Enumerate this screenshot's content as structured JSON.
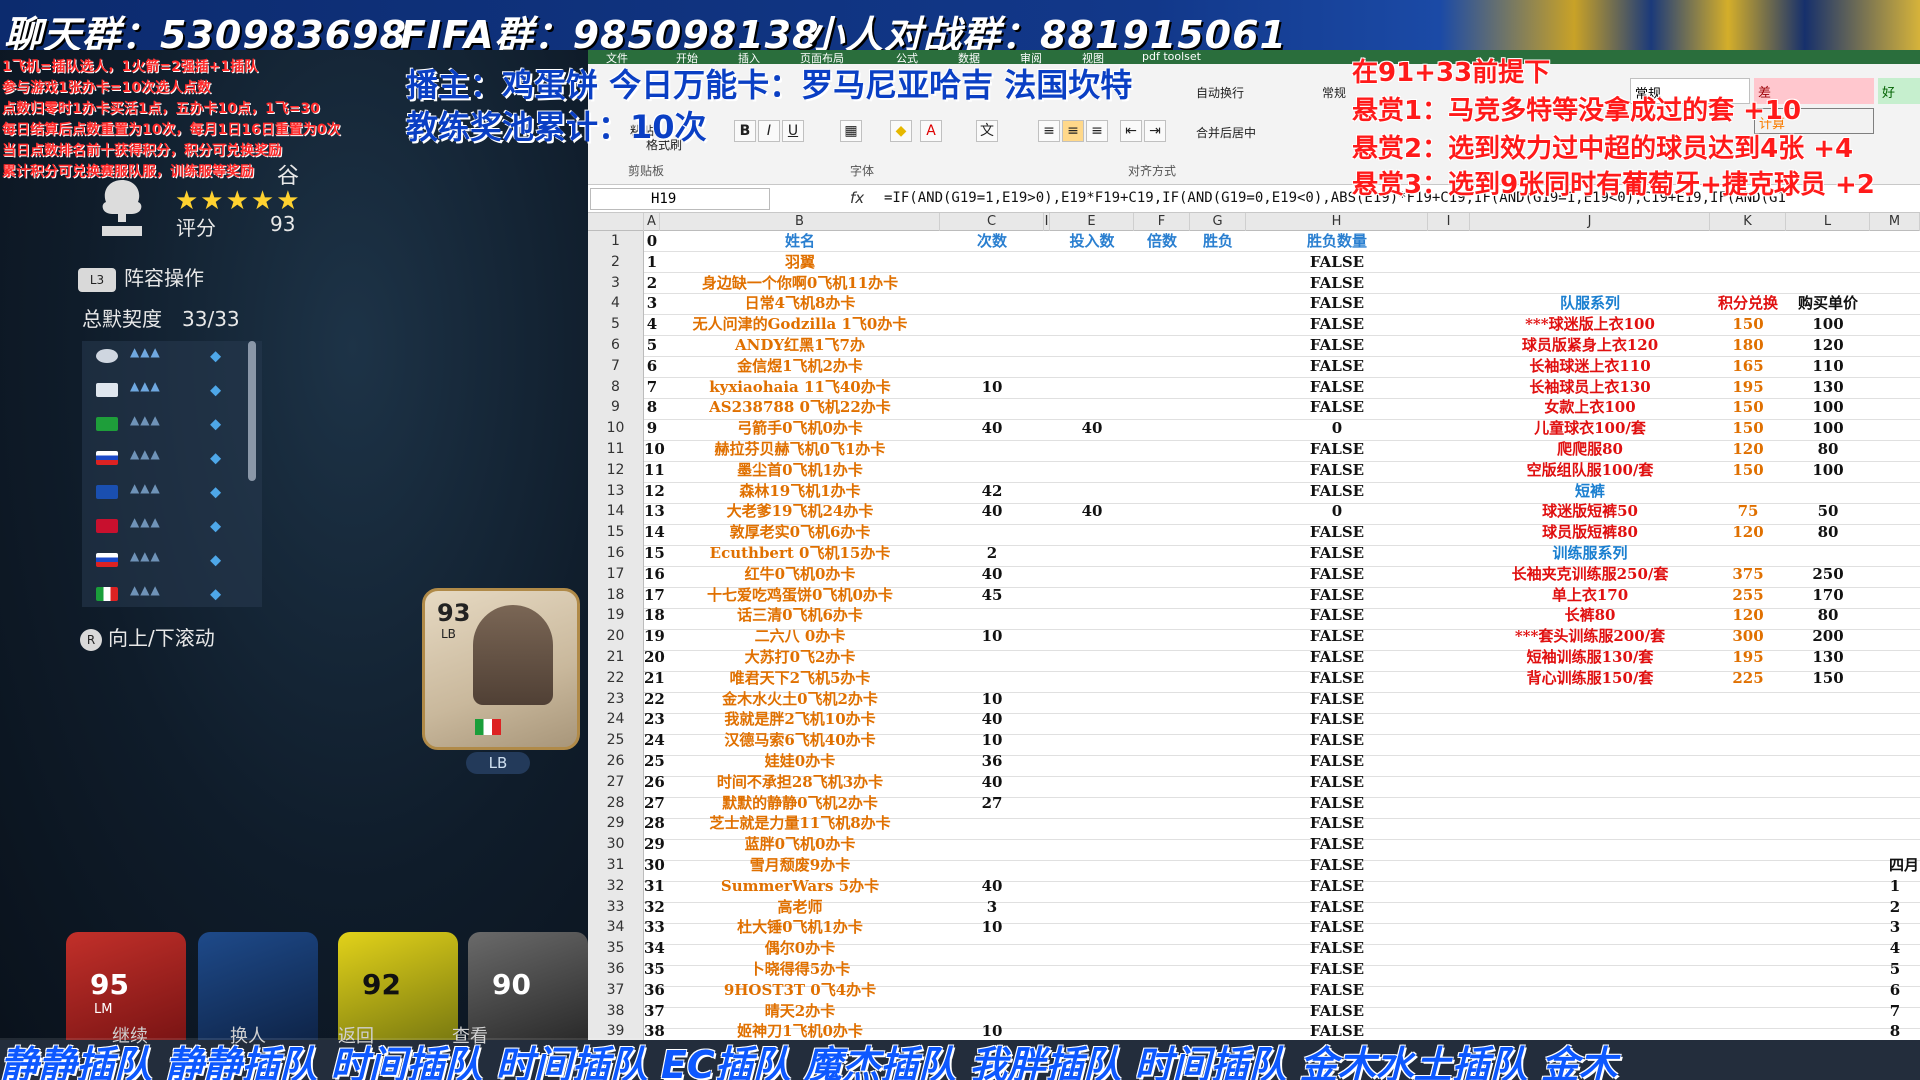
{
  "banner": {
    "chat_group": "聊天群：530983698",
    "fifa_group": "FIFA群：985098138",
    "pvp_group": "小人对战群：881915061"
  },
  "rules": [
    "1飞机=插队选人，1火箭=2强插+1插队",
    "参与游戏1张办卡=10次选人点数",
    "点数归零时1办卡买活1点，五办卡10点，1飞=30",
    "每日结算后点数重置为10次，每月1日16日重置为0次",
    "当日点数排名前十获得积分，积分可兑换奖励",
    "累计积分可兑换赛服队服，训练服等奖励"
  ],
  "host": {
    "line1": "播主：鸡蛋饼 今日万能卡：罗马尼亚哈吉 法国坎特",
    "line2": "教练奖池累计：10次"
  },
  "bounties": {
    "head": "在91+33前提下",
    "b1": "悬赏1：马竞多特等没拿成过的套 +10",
    "b2": "悬赏2：选到效力过中超的球员达到4张 +4",
    "b3": "悬赏3：选到9张同时有葡萄牙+捷克球员 +2"
  },
  "game": {
    "profile_label": "谷",
    "stars": "★★★★★",
    "score_label": "评分",
    "score_value": "93",
    "lineup_btn_icon": "L3",
    "lineup_btn": "阵容操作",
    "chem_label": "总默契度",
    "chem_value": "33/33",
    "scroll_hint": "向上/下滚动",
    "card": {
      "rating": "93",
      "pos": "LB"
    },
    "lb_tag": "LB",
    "bottom_cards": [
      {
        "rating": "95",
        "pos": "LM"
      },
      {
        "rating": "92",
        "pos": ""
      },
      {
        "rating": "90",
        "pos": ""
      }
    ],
    "bottom_btns": [
      "继续",
      "换人",
      "返回",
      "查看"
    ]
  },
  "excel": {
    "tabs": [
      "文件",
      "开始",
      "插入",
      "页面布局",
      "公式",
      "数据",
      "审阅",
      "视图",
      "pdf toolset"
    ],
    "font_group": "字体",
    "align_group": "对齐方式",
    "clipboard_group": "剪贴板",
    "wrap": "自动换行",
    "merge": "合并后居中",
    "paste": "粘贴",
    "format_painter": "格式刷",
    "style_normal": "常规",
    "style_bad": "差",
    "style_good": "好",
    "style_calc": "计算",
    "number_format": "常规",
    "name_box": "H19",
    "formula": "=IF(AND(G19=1,E19>0),E19*F19+C19,IF(AND(G19=0,E19<0),ABS(E19)*F19+C19,IF(AND(G19=1,E19<0),C19+E19,IF(AND(G1",
    "columns": [
      "A",
      "B",
      "C",
      "I",
      "E",
      "F",
      "G",
      "H",
      "I",
      "J",
      "K",
      "L",
      "M"
    ],
    "header_row": {
      "a": "0",
      "b": "姓名",
      "c": "次数",
      "e": "投入数",
      "f": "倍数",
      "g": "胜负",
      "h": "胜负数量"
    },
    "rows": [
      {
        "a": "1",
        "b": "羽翼",
        "c": "",
        "e": "",
        "h": "FALSE"
      },
      {
        "a": "2",
        "b": "身边缺一个你啊0飞机11办卡",
        "c": "",
        "e": "",
        "h": "FALSE"
      },
      {
        "a": "3",
        "b": "日常4飞机8办卡",
        "c": "",
        "e": "",
        "h": "FALSE"
      },
      {
        "a": "4",
        "b": "无人问津的Godzilla 1飞0办卡",
        "c": "",
        "e": "",
        "h": "FALSE"
      },
      {
        "a": "5",
        "b": "ANDY红黑1飞7办",
        "c": "",
        "e": "",
        "h": "FALSE"
      },
      {
        "a": "6",
        "b": "金信煜1飞机2办卡",
        "c": "",
        "e": "",
        "h": "FALSE"
      },
      {
        "a": "7",
        "b": "kyxiaohaia 11飞40办卡",
        "c": "10",
        "e": "",
        "h": "FALSE"
      },
      {
        "a": "8",
        "b": "AS238788 0飞机22办卡",
        "c": "",
        "e": "",
        "h": "FALSE"
      },
      {
        "a": "9",
        "b": "弓箭手0飞机0办卡",
        "c": "40",
        "e": "40",
        "h": "0"
      },
      {
        "a": "10",
        "b": "赫拉芬贝赫飞机0飞1办卡",
        "c": "",
        "e": "",
        "h": "FALSE"
      },
      {
        "a": "11",
        "b": "墨尘首0飞机1办卡",
        "c": "",
        "e": "",
        "h": "FALSE"
      },
      {
        "a": "12",
        "b": "森林19飞机1办卡",
        "c": "42",
        "e": "",
        "h": "FALSE"
      },
      {
        "a": "13",
        "b": "大老爹19飞机24办卡",
        "c": "40",
        "e": "40",
        "h": "0"
      },
      {
        "a": "14",
        "b": "敦厚老实0飞机6办卡",
        "c": "",
        "e": "",
        "h": "FALSE"
      },
      {
        "a": "15",
        "b": "Ecuthbert 0飞机15办卡",
        "c": "2",
        "e": "",
        "h": "FALSE"
      },
      {
        "a": "16",
        "b": "红牛0飞机0办卡",
        "c": "40",
        "e": "",
        "h": "FALSE"
      },
      {
        "a": "17",
        "b": "十七爱吃鸡蛋饼0飞机0办卡",
        "c": "45",
        "e": "",
        "h": "FALSE"
      },
      {
        "a": "18",
        "b": "话三清0飞机6办卡",
        "c": "",
        "e": "",
        "h": "FALSE"
      },
      {
        "a": "19",
        "b": "二六八 0办卡",
        "c": "10",
        "e": "",
        "h": "FALSE"
      },
      {
        "a": "20",
        "b": "大苏打0飞2办卡",
        "c": "",
        "e": "",
        "h": "FALSE"
      },
      {
        "a": "21",
        "b": "唯君天下2飞机5办卡",
        "c": "",
        "e": "",
        "h": "FALSE"
      },
      {
        "a": "22",
        "b": "金木水火土0飞机2办卡",
        "c": "10",
        "e": "",
        "h": "FALSE"
      },
      {
        "a": "23",
        "b": "我就是胖2飞机10办卡",
        "c": "40",
        "e": "",
        "h": "FALSE"
      },
      {
        "a": "24",
        "b": "汉德马索6飞机40办卡",
        "c": "10",
        "e": "",
        "h": "FALSE"
      },
      {
        "a": "25",
        "b": "娃娃0办卡",
        "c": "36",
        "e": "",
        "h": "FALSE"
      },
      {
        "a": "26",
        "b": "时间不承担28飞机3办卡",
        "c": "40",
        "e": "",
        "h": "FALSE"
      },
      {
        "a": "27",
        "b": "默默的静静0飞机2办卡",
        "c": "27",
        "e": "",
        "h": "FALSE"
      },
      {
        "a": "28",
        "b": "芝士就是力量11飞机8办卡",
        "c": "",
        "e": "",
        "h": "FALSE"
      },
      {
        "a": "29",
        "b": "蓝胖0飞机0办卡",
        "c": "",
        "e": "",
        "h": "FALSE"
      },
      {
        "a": "30",
        "b": "雪月颓废9办卡",
        "c": "",
        "e": "",
        "h": "FALSE"
      },
      {
        "a": "31",
        "b": "SummerWars 5办卡",
        "c": "40",
        "e": "",
        "h": "FALSE"
      },
      {
        "a": "32",
        "b": "高老师",
        "c": "3",
        "e": "",
        "h": "FALSE"
      },
      {
        "a": "33",
        "b": "杜大锤0飞机1办卡",
        "c": "10",
        "e": "",
        "h": "FALSE"
      },
      {
        "a": "34",
        "b": "偶尔0办卡",
        "c": "",
        "e": "",
        "h": "FALSE"
      },
      {
        "a": "35",
        "b": "卜晓得得5办卡",
        "c": "",
        "e": "",
        "h": "FALSE"
      },
      {
        "a": "36",
        "b": "9HOST3T 0飞4办卡",
        "c": "",
        "e": "",
        "h": "FALSE"
      },
      {
        "a": "37",
        "b": "晴天2办卡",
        "c": "",
        "e": "",
        "h": "FALSE"
      },
      {
        "a": "38",
        "b": "姬神刀1飞机0办卡",
        "c": "10",
        "e": "",
        "h": "FALSE"
      }
    ],
    "shop_header": {
      "j": "队服系列",
      "k": "积分兑换",
      "l": "购买单价"
    },
    "shop": [
      {
        "j": "***球迷版上衣100",
        "k": "150",
        "l": "100",
        "color": "#e01010"
      },
      {
        "j": "球员版紧身上衣120",
        "k": "180",
        "l": "120",
        "color": "#e01010"
      },
      {
        "j": "长袖球迷上衣110",
        "k": "165",
        "l": "110",
        "color": "#e01010"
      },
      {
        "j": "长袖球员上衣130",
        "k": "195",
        "l": "130",
        "color": "#e01010"
      },
      {
        "j": "女款上衣100",
        "k": "150",
        "l": "100",
        "color": "#e01010"
      },
      {
        "j": "儿童球衣100/套",
        "k": "150",
        "l": "100",
        "color": "#e01010"
      },
      {
        "j": "爬爬服80",
        "k": "120",
        "l": "80",
        "color": "#e01010"
      },
      {
        "j": "空版组队服100/套",
        "k": "150",
        "l": "100",
        "color": "#e01010"
      },
      {
        "j": "短裤",
        "k": "",
        "l": "",
        "color": "#1a7fd0"
      },
      {
        "j": "球迷版短裤50",
        "k": "75",
        "l": "50",
        "color": "#e01010"
      },
      {
        "j": "球员版短裤80",
        "k": "120",
        "l": "80",
        "color": "#e01010"
      },
      {
        "j": "训练服系列",
        "k": "",
        "l": "",
        "color": "#1a7fd0"
      },
      {
        "j": "长袖夹克训练服250/套",
        "k": "375",
        "l": "250",
        "color": "#e01010"
      },
      {
        "j": "单上衣170",
        "k": "255",
        "l": "170",
        "color": "#e01010"
      },
      {
        "j": "长裤80",
        "k": "120",
        "l": "80",
        "color": "#e01010"
      },
      {
        "j": "***套头训练服200/套",
        "k": "300",
        "l": "200",
        "color": "#e01010"
      },
      {
        "j": "短袖训练服130/套",
        "k": "195",
        "l": "130",
        "color": "#e01010"
      },
      {
        "j": "背心训练服150/套",
        "k": "225",
        "l": "150",
        "color": "#e01010"
      }
    ],
    "m_col": [
      "1",
      "2",
      "3",
      "4",
      "5",
      "6",
      "7",
      "8"
    ],
    "april": "四月"
  },
  "bottom_scroll": "静静插队 静静插队 时间插队 时间插队 EC插队 魔杰插队 我胖插队 时间插队 金木水土插队 金木"
}
